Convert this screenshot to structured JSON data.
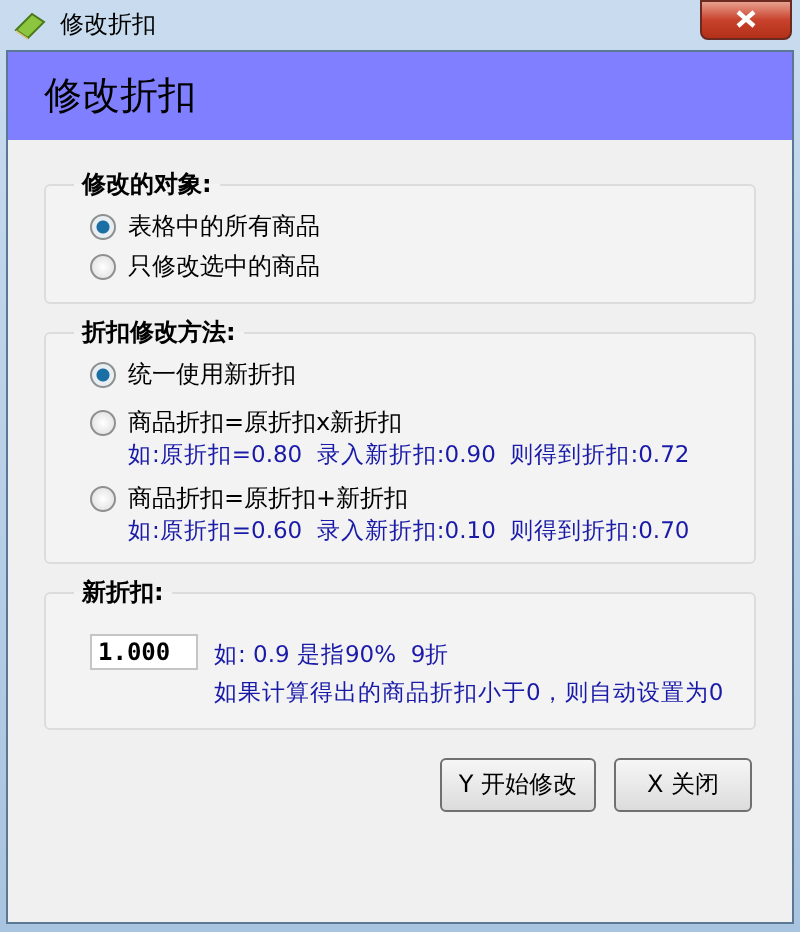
{
  "window": {
    "title": "修改折扣"
  },
  "header": {
    "title": "修改折扣"
  },
  "groups": [
    {
      "label": "修改的对象:",
      "options": [
        {
          "label": "表格中的所有商品",
          "selected": true
        },
        {
          "label": "只修改选中的商品",
          "selected": false
        }
      ]
    },
    {
      "label": "折扣修改方法:",
      "options": [
        {
          "label": "统一使用新折扣",
          "selected": true
        },
        {
          "label": "商品折扣=原折扣x新折扣",
          "selected": false,
          "example": "如:原折扣=0.80  录入新折扣:0.90  则得到折扣:0.72"
        },
        {
          "label": "商品折扣=原折扣+新折扣",
          "selected": false,
          "example": "如:原折扣=0.60  录入新折扣:0.10  则得到折扣:0.70"
        }
      ]
    }
  ],
  "new_discount": {
    "label": "新折扣:",
    "value": "1.000",
    "hints": [
      "如: 0.9 是指90%  9折",
      "如果计算得出的商品折扣小于0，则自动设置为0"
    ]
  },
  "buttons": [
    "Y 开始修改",
    "X 关闭"
  ]
}
